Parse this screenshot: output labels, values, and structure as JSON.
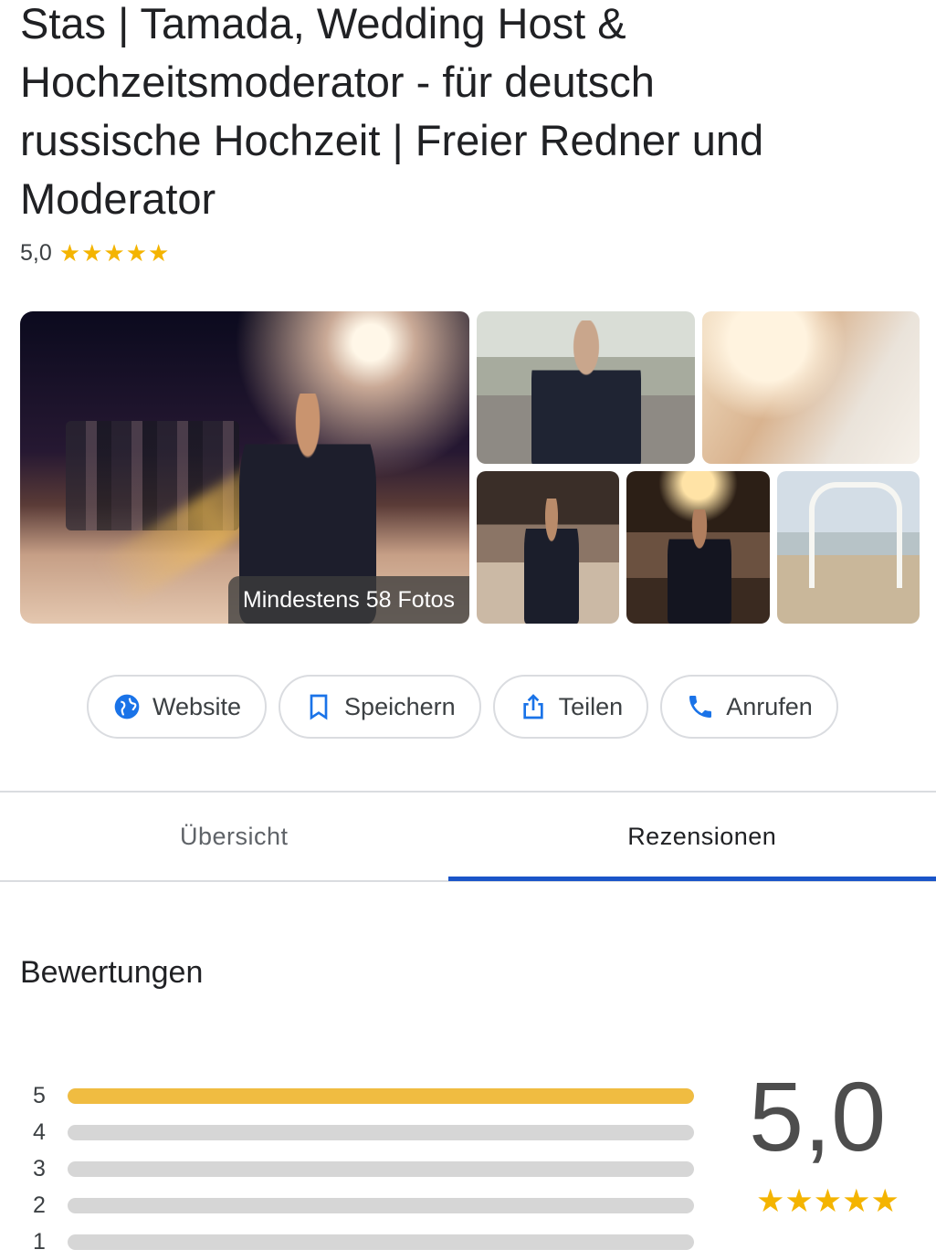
{
  "business": {
    "name": "Stas | Tamada, Wedding Host & Hochzeitsmoderator - für deutsch russische Hochzeit | Freier Redner und Moderator",
    "rating": "5,0",
    "stars": "★★★★★"
  },
  "photos": {
    "badge": "Mindestens 58 Fotos"
  },
  "actions": {
    "website": "Website",
    "save": "Speichern",
    "share": "Teilen",
    "call": "Anrufen"
  },
  "tabs": {
    "overview": "Übersicht",
    "reviews": "Rezensionen",
    "active": "reviews"
  },
  "ratings_section": {
    "title": "Bewertungen",
    "score": "5,0",
    "stars": "★★★★★",
    "distribution": [
      {
        "label": "5",
        "fraction": 1.0
      },
      {
        "label": "4",
        "fraction": 0.0
      },
      {
        "label": "3",
        "fraction": 0.0
      },
      {
        "label": "2",
        "fraction": 0.0
      },
      {
        "label": "1",
        "fraction": 0.0
      }
    ]
  },
  "colors": {
    "star": "#f4b400",
    "bar_fill": "#f0bc41",
    "tab_indicator": "#1a55c8",
    "icon_blue": "#1a73e8"
  }
}
